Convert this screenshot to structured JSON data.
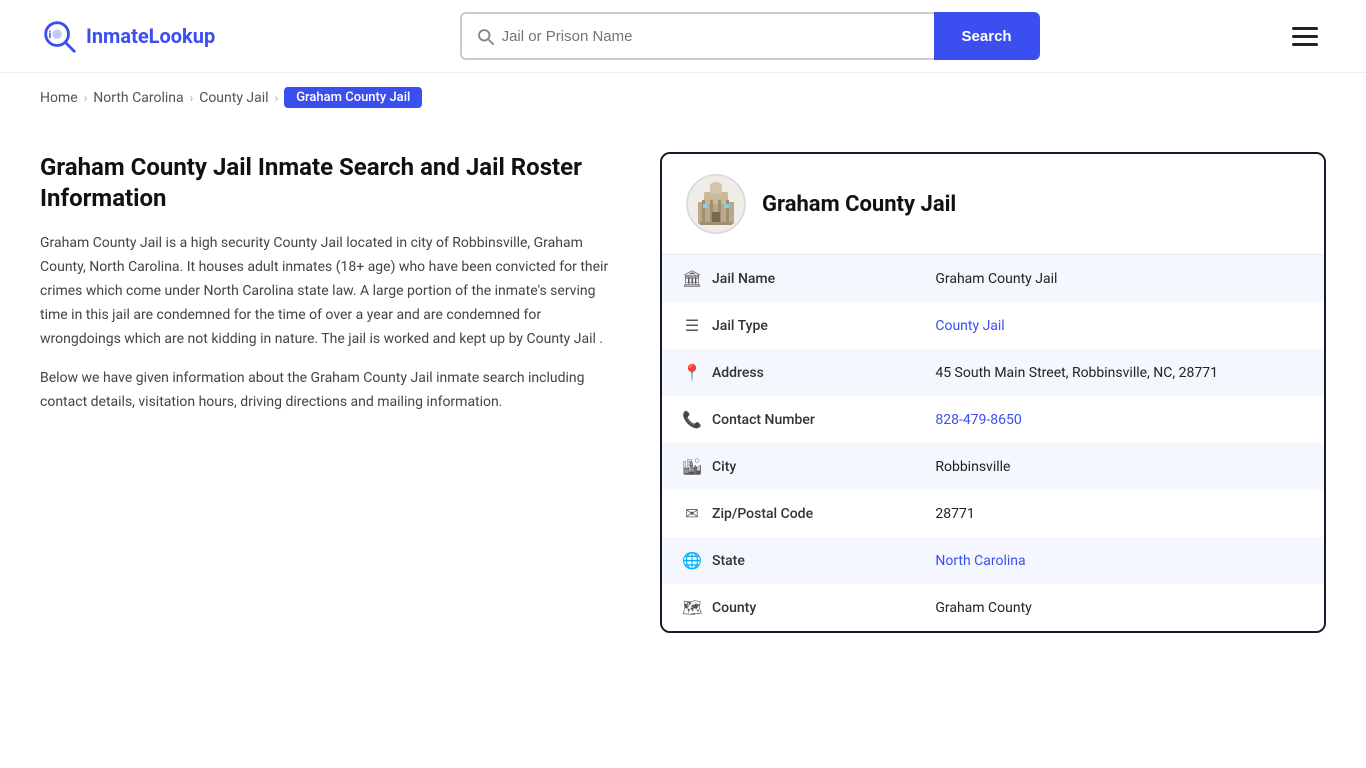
{
  "header": {
    "logo_text_part1": "Inmate",
    "logo_text_part2": "Lookup",
    "search_placeholder": "Jail or Prison Name",
    "search_button_label": "Search"
  },
  "breadcrumb": {
    "home": "Home",
    "state": "North Carolina",
    "type": "County Jail",
    "current": "Graham County Jail"
  },
  "page": {
    "heading": "Graham County Jail Inmate Search and Jail Roster Information",
    "paragraph1": "Graham County Jail is a high security County Jail located in city of Robbinsville, Graham County, North Carolina. It houses adult inmates (18+ age) who have been convicted for their crimes which come under North Carolina state law. A large portion of the inmate's serving time in this jail are condemned for the time of over a year and are condemned for wrongdoings which are not kidding in nature. The jail is worked and kept up by County Jail .",
    "paragraph2": "Below we have given information about the Graham County Jail inmate search including contact details, visitation hours, driving directions and mailing information."
  },
  "jail_info": {
    "card_title": "Graham County Jail",
    "rows": [
      {
        "icon": "🏛",
        "label": "Jail Name",
        "value": "Graham County Jail",
        "link": false
      },
      {
        "icon": "☰",
        "label": "Jail Type",
        "value": "County Jail",
        "link": true,
        "href": "#"
      },
      {
        "icon": "📍",
        "label": "Address",
        "value": "45 South Main Street, Robbinsville, NC, 28771",
        "link": false
      },
      {
        "icon": "📞",
        "label": "Contact Number",
        "value": "828-479-8650",
        "link": true,
        "href": "tel:828-479-8650"
      },
      {
        "icon": "🏙",
        "label": "City",
        "value": "Robbinsville",
        "link": false
      },
      {
        "icon": "✉",
        "label": "Zip/Postal Code",
        "value": "28771",
        "link": false
      },
      {
        "icon": "🌐",
        "label": "State",
        "value": "North Carolina",
        "link": true,
        "href": "#"
      },
      {
        "icon": "🗺",
        "label": "County",
        "value": "Graham County",
        "link": false
      }
    ]
  }
}
